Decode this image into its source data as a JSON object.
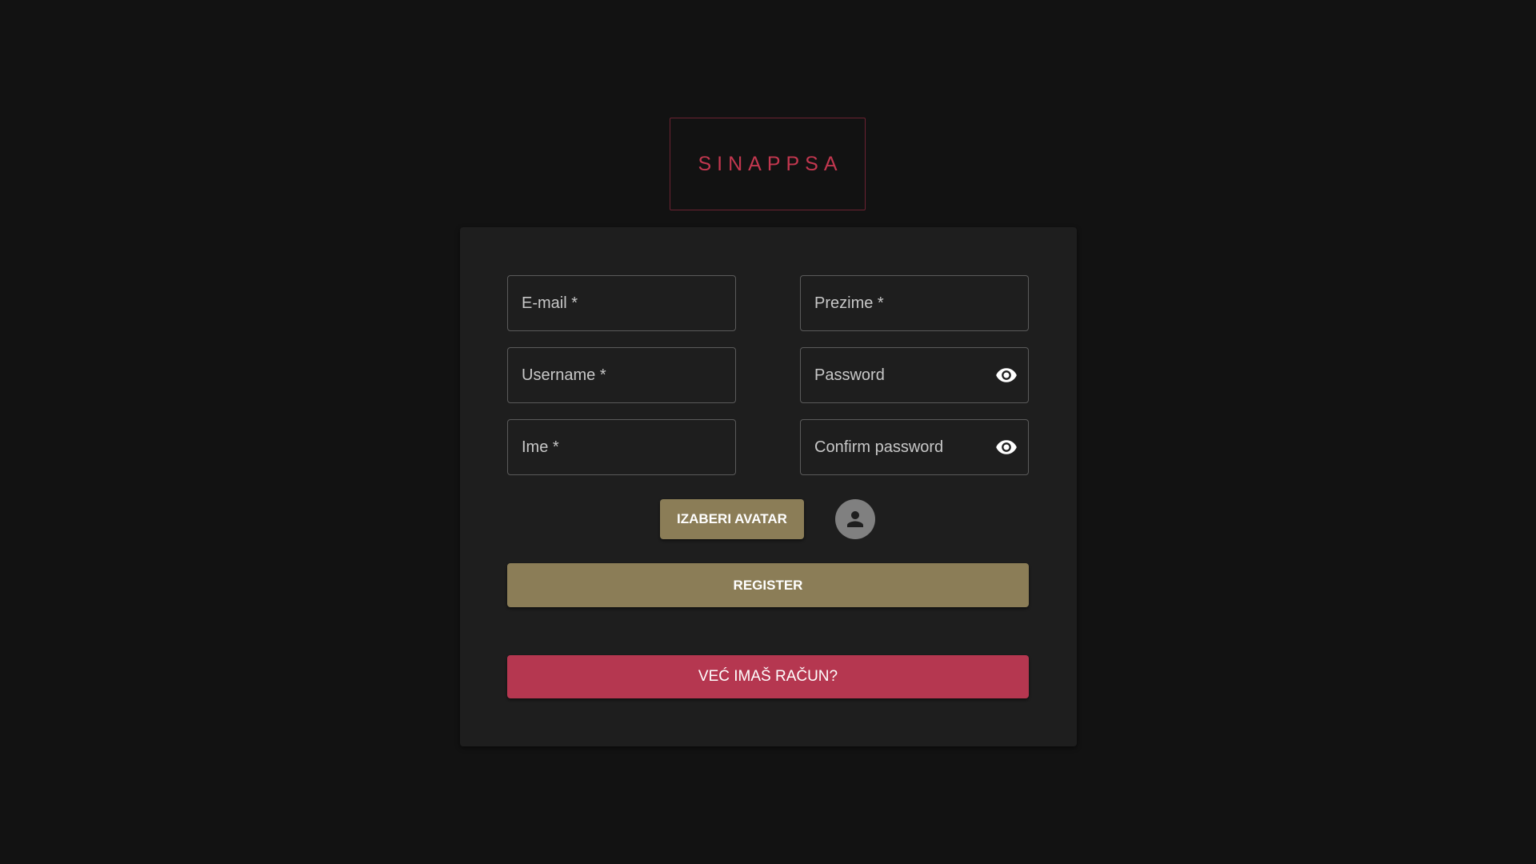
{
  "app": {
    "logo_text": "SINAPPSA"
  },
  "form": {
    "fields": {
      "email": {
        "label": "E-mail *",
        "value": ""
      },
      "prezime": {
        "label": "Prezime *",
        "value": ""
      },
      "username": {
        "label": "Username *",
        "value": ""
      },
      "password": {
        "label": "Password",
        "value": "",
        "icon": "eye-icon"
      },
      "ime": {
        "label": "Ime *",
        "value": ""
      },
      "confirm_password": {
        "label": "Confirm password",
        "value": "",
        "icon": "eye-icon"
      }
    },
    "avatar_button_label": "IZABERI AVATAR",
    "avatar_icon": "person-icon",
    "register_label": "REGISTER",
    "login_label": "VEĆ IMAŠ RAČUN?"
  },
  "colors": {
    "background": "#121212",
    "card": "#1e1e1e",
    "brand": "#c2374f",
    "primary_button": "#8b7d57",
    "secondary_button": "#b53750"
  }
}
